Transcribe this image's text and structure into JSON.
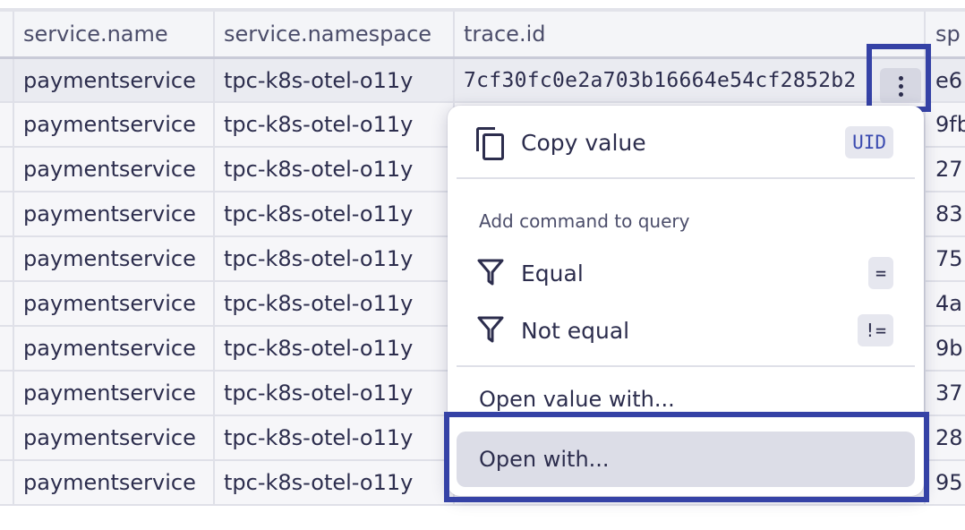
{
  "table": {
    "columns": [
      "service.name",
      "service.namespace",
      "trace.id",
      "sp"
    ],
    "rows": [
      {
        "service_name": "paymentservice",
        "service_namespace": "tpc-k8s-otel-o11y",
        "trace_id": "7cf30fc0e2a703b16664e54cf2852b2",
        "span_prefix": "e6"
      },
      {
        "service_name": "paymentservice",
        "service_namespace": "tpc-k8s-otel-o11y",
        "trace_id": "",
        "span_prefix": "9fb"
      },
      {
        "service_name": "paymentservice",
        "service_namespace": "tpc-k8s-otel-o11y",
        "trace_id": "",
        "span_prefix": "27"
      },
      {
        "service_name": "paymentservice",
        "service_namespace": "tpc-k8s-otel-o11y",
        "trace_id": "",
        "span_prefix": "83"
      },
      {
        "service_name": "paymentservice",
        "service_namespace": "tpc-k8s-otel-o11y",
        "trace_id": "",
        "span_prefix": "75"
      },
      {
        "service_name": "paymentservice",
        "service_namespace": "tpc-k8s-otel-o11y",
        "trace_id": "",
        "span_prefix": "4a"
      },
      {
        "service_name": "paymentservice",
        "service_namespace": "tpc-k8s-otel-o11y",
        "trace_id": "",
        "span_prefix": "9b"
      },
      {
        "service_name": "paymentservice",
        "service_namespace": "tpc-k8s-otel-o11y",
        "trace_id": "",
        "span_prefix": "37"
      },
      {
        "service_name": "paymentservice",
        "service_namespace": "tpc-k8s-otel-o11y",
        "trace_id": "",
        "span_prefix": "28"
      },
      {
        "service_name": "paymentservice",
        "service_namespace": "tpc-k8s-otel-o11y",
        "trace_id": "",
        "span_prefix": "95"
      }
    ]
  },
  "context_menu": {
    "copy_value": {
      "label": "Copy value",
      "shortcut": "UID",
      "icon": "copy-icon"
    },
    "section_label": "Add command to query",
    "equal": {
      "label": "Equal",
      "shortcut": "=",
      "icon": "filter-icon"
    },
    "not_equal": {
      "label": "Not equal",
      "shortcut": "!=",
      "icon": "filter-icon"
    },
    "open_value_with": {
      "label": "Open value with..."
    },
    "open_with": {
      "label": "Open with..."
    }
  },
  "colors": {
    "highlight_border": "#3542a6",
    "text": "#2c2d4d",
    "accent": "#3b4bb0",
    "hover_background": "#dcdde7"
  }
}
